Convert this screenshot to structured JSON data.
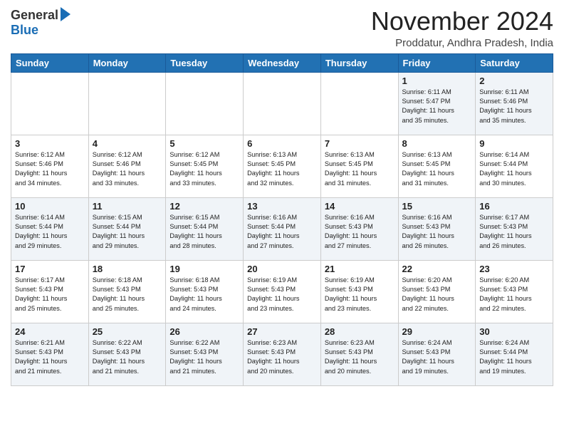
{
  "logo": {
    "general": "General",
    "blue": "Blue"
  },
  "header": {
    "month": "November 2024",
    "location": "Proddatur, Andhra Pradesh, India"
  },
  "weekdays": [
    "Sunday",
    "Monday",
    "Tuesday",
    "Wednesday",
    "Thursday",
    "Friday",
    "Saturday"
  ],
  "weeks": [
    [
      {
        "day": "",
        "info": ""
      },
      {
        "day": "",
        "info": ""
      },
      {
        "day": "",
        "info": ""
      },
      {
        "day": "",
        "info": ""
      },
      {
        "day": "",
        "info": ""
      },
      {
        "day": "1",
        "info": "Sunrise: 6:11 AM\nSunset: 5:47 PM\nDaylight: 11 hours\nand 35 minutes."
      },
      {
        "day": "2",
        "info": "Sunrise: 6:11 AM\nSunset: 5:46 PM\nDaylight: 11 hours\nand 35 minutes."
      }
    ],
    [
      {
        "day": "3",
        "info": "Sunrise: 6:12 AM\nSunset: 5:46 PM\nDaylight: 11 hours\nand 34 minutes."
      },
      {
        "day": "4",
        "info": "Sunrise: 6:12 AM\nSunset: 5:46 PM\nDaylight: 11 hours\nand 33 minutes."
      },
      {
        "day": "5",
        "info": "Sunrise: 6:12 AM\nSunset: 5:45 PM\nDaylight: 11 hours\nand 33 minutes."
      },
      {
        "day": "6",
        "info": "Sunrise: 6:13 AM\nSunset: 5:45 PM\nDaylight: 11 hours\nand 32 minutes."
      },
      {
        "day": "7",
        "info": "Sunrise: 6:13 AM\nSunset: 5:45 PM\nDaylight: 11 hours\nand 31 minutes."
      },
      {
        "day": "8",
        "info": "Sunrise: 6:13 AM\nSunset: 5:45 PM\nDaylight: 11 hours\nand 31 minutes."
      },
      {
        "day": "9",
        "info": "Sunrise: 6:14 AM\nSunset: 5:44 PM\nDaylight: 11 hours\nand 30 minutes."
      }
    ],
    [
      {
        "day": "10",
        "info": "Sunrise: 6:14 AM\nSunset: 5:44 PM\nDaylight: 11 hours\nand 29 minutes."
      },
      {
        "day": "11",
        "info": "Sunrise: 6:15 AM\nSunset: 5:44 PM\nDaylight: 11 hours\nand 29 minutes."
      },
      {
        "day": "12",
        "info": "Sunrise: 6:15 AM\nSunset: 5:44 PM\nDaylight: 11 hours\nand 28 minutes."
      },
      {
        "day": "13",
        "info": "Sunrise: 6:16 AM\nSunset: 5:44 PM\nDaylight: 11 hours\nand 27 minutes."
      },
      {
        "day": "14",
        "info": "Sunrise: 6:16 AM\nSunset: 5:43 PM\nDaylight: 11 hours\nand 27 minutes."
      },
      {
        "day": "15",
        "info": "Sunrise: 6:16 AM\nSunset: 5:43 PM\nDaylight: 11 hours\nand 26 minutes."
      },
      {
        "day": "16",
        "info": "Sunrise: 6:17 AM\nSunset: 5:43 PM\nDaylight: 11 hours\nand 26 minutes."
      }
    ],
    [
      {
        "day": "17",
        "info": "Sunrise: 6:17 AM\nSunset: 5:43 PM\nDaylight: 11 hours\nand 25 minutes."
      },
      {
        "day": "18",
        "info": "Sunrise: 6:18 AM\nSunset: 5:43 PM\nDaylight: 11 hours\nand 25 minutes."
      },
      {
        "day": "19",
        "info": "Sunrise: 6:18 AM\nSunset: 5:43 PM\nDaylight: 11 hours\nand 24 minutes."
      },
      {
        "day": "20",
        "info": "Sunrise: 6:19 AM\nSunset: 5:43 PM\nDaylight: 11 hours\nand 23 minutes."
      },
      {
        "day": "21",
        "info": "Sunrise: 6:19 AM\nSunset: 5:43 PM\nDaylight: 11 hours\nand 23 minutes."
      },
      {
        "day": "22",
        "info": "Sunrise: 6:20 AM\nSunset: 5:43 PM\nDaylight: 11 hours\nand 22 minutes."
      },
      {
        "day": "23",
        "info": "Sunrise: 6:20 AM\nSunset: 5:43 PM\nDaylight: 11 hours\nand 22 minutes."
      }
    ],
    [
      {
        "day": "24",
        "info": "Sunrise: 6:21 AM\nSunset: 5:43 PM\nDaylight: 11 hours\nand 21 minutes."
      },
      {
        "day": "25",
        "info": "Sunrise: 6:22 AM\nSunset: 5:43 PM\nDaylight: 11 hours\nand 21 minutes."
      },
      {
        "day": "26",
        "info": "Sunrise: 6:22 AM\nSunset: 5:43 PM\nDaylight: 11 hours\nand 21 minutes."
      },
      {
        "day": "27",
        "info": "Sunrise: 6:23 AM\nSunset: 5:43 PM\nDaylight: 11 hours\nand 20 minutes."
      },
      {
        "day": "28",
        "info": "Sunrise: 6:23 AM\nSunset: 5:43 PM\nDaylight: 11 hours\nand 20 minutes."
      },
      {
        "day": "29",
        "info": "Sunrise: 6:24 AM\nSunset: 5:43 PM\nDaylight: 11 hours\nand 19 minutes."
      },
      {
        "day": "30",
        "info": "Sunrise: 6:24 AM\nSunset: 5:44 PM\nDaylight: 11 hours\nand 19 minutes."
      }
    ]
  ]
}
